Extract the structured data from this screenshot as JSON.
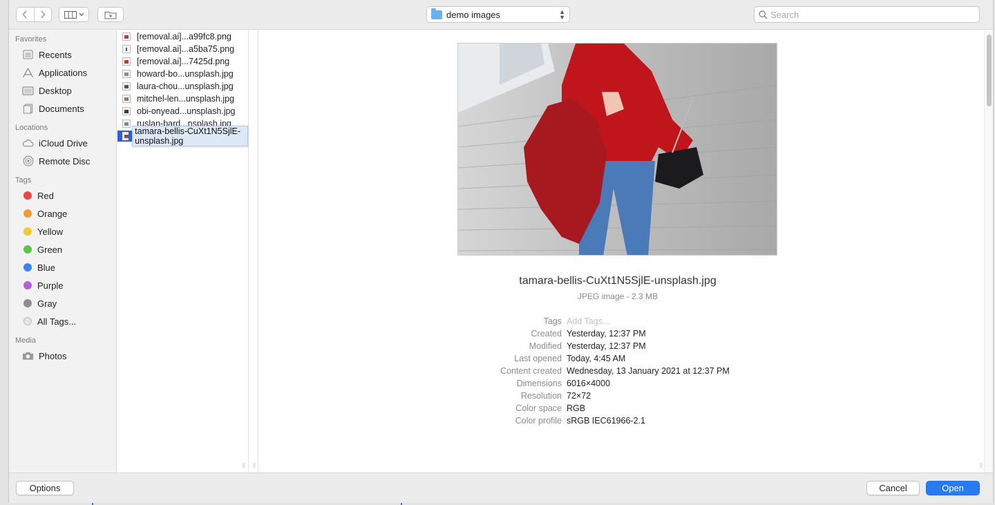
{
  "toolbar": {
    "path_label": "demo images",
    "search_placeholder": "Search"
  },
  "sidebar": {
    "favorites_title": "Favorites",
    "favorites": [
      {
        "label": "Recents",
        "icon": "recents-icon"
      },
      {
        "label": "Applications",
        "icon": "applications-icon"
      },
      {
        "label": "Desktop",
        "icon": "desktop-icon"
      },
      {
        "label": "Documents",
        "icon": "documents-icon"
      }
    ],
    "locations_title": "Locations",
    "locations": [
      {
        "label": "iCloud Drive",
        "icon": "cloud-icon"
      },
      {
        "label": "Remote Disc",
        "icon": "disc-icon"
      }
    ],
    "tags_title": "Tags",
    "tags": [
      {
        "label": "Red",
        "color": "#f0463e"
      },
      {
        "label": "Orange",
        "color": "#f29a33"
      },
      {
        "label": "Yellow",
        "color": "#f4c733"
      },
      {
        "label": "Green",
        "color": "#5fc54a"
      },
      {
        "label": "Blue",
        "color": "#3a86f0"
      },
      {
        "label": "Purple",
        "color": "#b260d6"
      },
      {
        "label": "Gray",
        "color": "#8e8e8e"
      },
      {
        "label": "All Tags...",
        "color": "#d6d6d6"
      }
    ],
    "media_title": "Media",
    "media": [
      {
        "label": "Photos",
        "icon": "camera-icon"
      }
    ]
  },
  "files": [
    {
      "name": "[removal.ai]...a99fc8.png",
      "thumb_color": "#c0392b"
    },
    {
      "name": "[removal.ai]...a5ba75.png",
      "thumb_color": "#555555"
    },
    {
      "name": "[removal.ai]...7425d.png",
      "thumb_color": "#c0392b"
    },
    {
      "name": "howard-bo...unsplash.jpg",
      "thumb_color": "#8a8a8a"
    },
    {
      "name": "laura-chou...unsplash.jpg",
      "thumb_color": "#7a4a2e"
    },
    {
      "name": "mitchel-len...unsplash.jpg",
      "thumb_color": "#9b7a5a"
    },
    {
      "name": "obi-onyead...unsplash.jpg",
      "thumb_color": "#3a3a3a"
    },
    {
      "name": "ruslan-bard...nsplash.jpg",
      "thumb_color": "#6f8fa8"
    },
    {
      "name": "tamara-bellis-CuXt1N5SjlE-unsplash.jpg",
      "thumb_color": "#c0392b",
      "selected": true
    }
  ],
  "preview": {
    "file_name": "tamara-bellis-CuXt1N5SjlE-unsplash.jpg",
    "kind": "JPEG image - 2.3 MB",
    "meta": [
      {
        "key": "Tags",
        "value": "Add Tags...",
        "placeholder": true
      },
      {
        "key": "Created",
        "value": "Yesterday, 12:37 PM"
      },
      {
        "key": "Modified",
        "value": "Yesterday, 12:37 PM"
      },
      {
        "key": "Last opened",
        "value": "Today, 4:45 AM"
      },
      {
        "key": "Content created",
        "value": "Wednesday, 13 January 2021 at 12:37 PM"
      },
      {
        "key": "Dimensions",
        "value": "6016×4000"
      },
      {
        "key": "Resolution",
        "value": "72×72"
      },
      {
        "key": "Color space",
        "value": "RGB"
      },
      {
        "key": "Color profile",
        "value": "sRGB IEC61966-2.1"
      }
    ]
  },
  "footer": {
    "options_label": "Options",
    "cancel_label": "Cancel",
    "open_label": "Open"
  },
  "colors": {
    "accent": "#2a7bf3",
    "selection": "#2c61d6"
  }
}
